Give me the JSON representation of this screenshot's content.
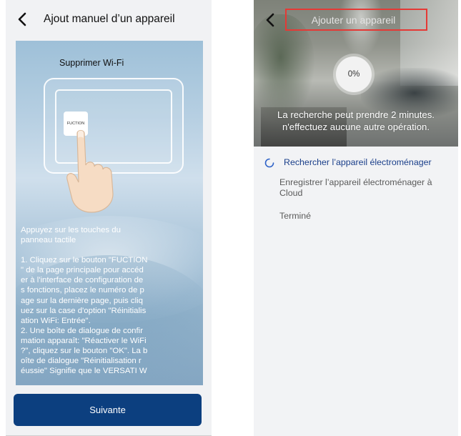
{
  "left": {
    "header": {
      "title": "Ajout manuel d’un appareil"
    },
    "illustration": {
      "heading": "Supprimer  Wi-Fi",
      "button_label": "FUCTION",
      "paragraphs": [
        "Appuyez sur les touches du\npanneau tactile",
        "1. Cliquez sur le bouton \"FUCTION\n\" de la page principale pour accéd\ner à l'interface de configuration de\ns fonctions, placez le numéro de p\nage sur la dernière page, puis cliq\nuez sur la case d'option \"Réinitialis\nation WiFi: Entrée\".\n2. Une boîte de dialogue de confir\nmation apparaît: \"Réactiver le WiFi\n?\", cliquez sur le bouton \"OK\". La b\noîte de dialogue \"Réinitialisation r\néussie\" Signifie que le VERSATI W"
      ]
    },
    "next_button": "Suivante"
  },
  "right": {
    "header": {
      "title": "Ajouter un appareil"
    },
    "progress": "0%",
    "message": [
      "La recherche peut prendre 2 minutes.",
      "n'effectuez aucune autre opération."
    ],
    "steps": [
      {
        "label": "Rechercher l’appareil électroménager",
        "status": "active"
      },
      {
        "label": "Enregistrer l’appareil électroménager à Cloud",
        "status": "pending"
      },
      {
        "label": "Terminé",
        "status": "pending"
      }
    ],
    "colors": {
      "highlight_box": "#e53935",
      "accent": "#1a3f8a"
    }
  },
  "colors": {
    "primary_button": "#0c3f7f"
  }
}
